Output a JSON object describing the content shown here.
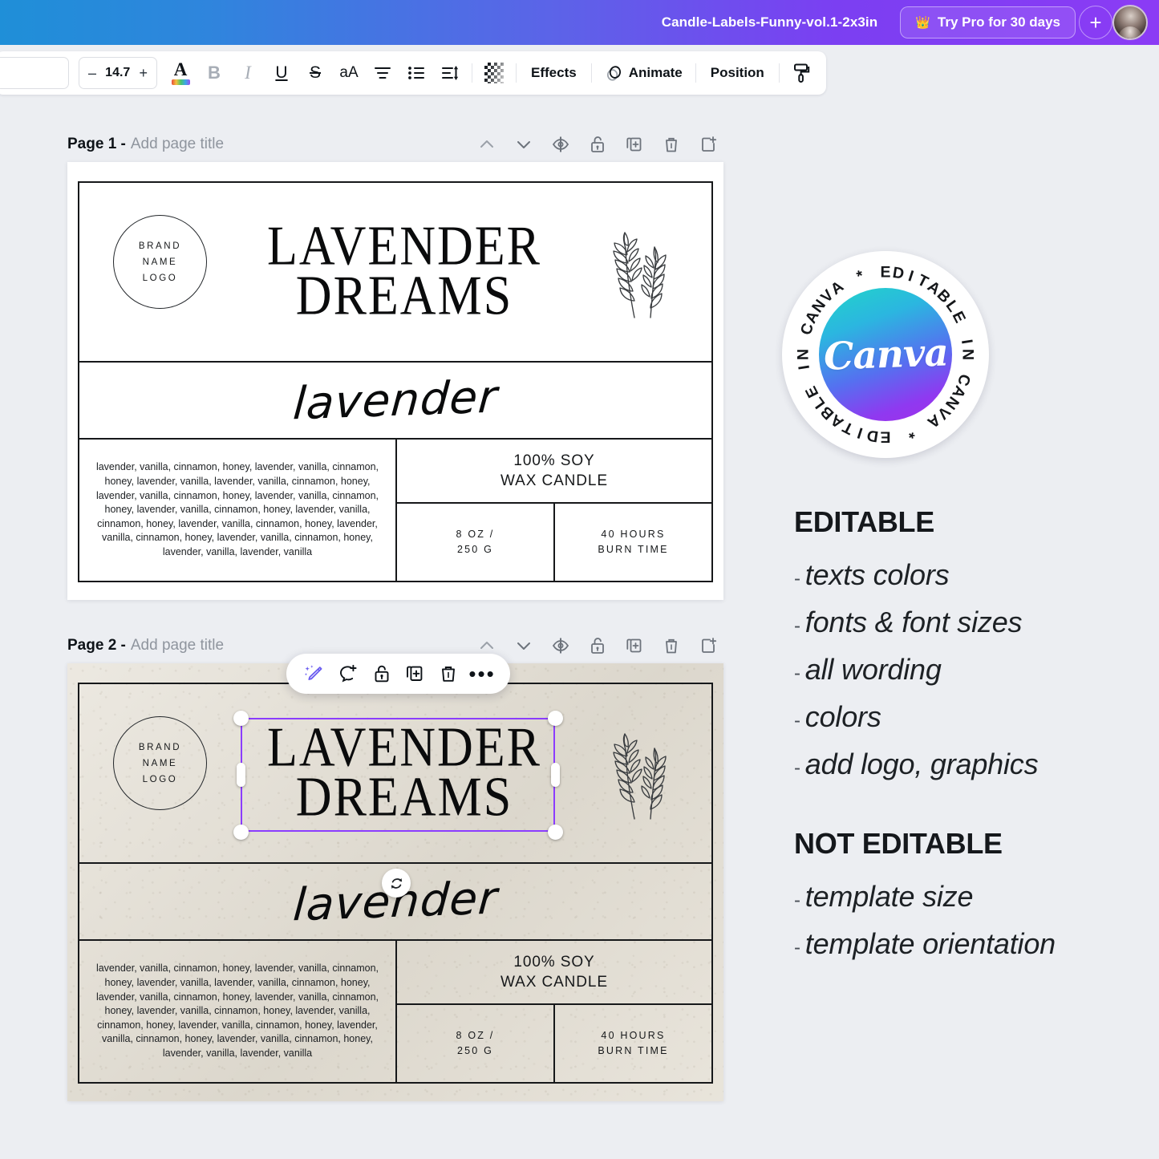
{
  "topbar": {
    "doc_title": "Candle-Labels-Funny-vol.1-2x3in",
    "try_pro_label": "Try Pro for 30 days",
    "crown_icon": "crown-icon",
    "avatar_icon": "user-avatar",
    "plus_label": "+"
  },
  "toolbar": {
    "font_name": "",
    "font_size": "14.7",
    "decrease": "–",
    "increase": "+",
    "text_color_letter": "A",
    "bold": "B",
    "italic": "I",
    "underline": "U",
    "strikethrough": "S",
    "case": "aA",
    "effects_label": "Effects",
    "animate_label": "Animate",
    "position_label": "Position",
    "icons": [
      "text-color-icon",
      "bold-icon",
      "italic-icon",
      "underline-icon",
      "strikethrough-icon",
      "letter-case-icon",
      "align-icon",
      "list-icon",
      "line-spacing-icon",
      "transparency-icon",
      "animate-icon",
      "copy-style-icon"
    ]
  },
  "pages": [
    {
      "number_label": "Page 1 -",
      "title_placeholder": "Add page title",
      "icons": [
        "chevron-up-icon",
        "chevron-down-icon",
        "hide-page-icon",
        "lock-page-icon",
        "duplicate-page-icon",
        "delete-page-icon",
        "add-page-icon"
      ],
      "theme": "white"
    },
    {
      "number_label": "Page 2 -",
      "title_placeholder": "Add page title",
      "icons": [
        "chevron-up-icon",
        "chevron-down-icon",
        "hide-page-icon",
        "lock-page-icon",
        "duplicate-page-icon",
        "delete-page-icon",
        "add-page-icon"
      ],
      "theme": "kraft"
    }
  ],
  "label": {
    "brand_lines": [
      "BRAND",
      "NAME",
      "LOGO"
    ],
    "title_line1": "LAVENDER",
    "title_line2": "DREAMS",
    "script_word": "lavender",
    "ingredients": "lavender, vanilla, cinnamon, honey, lavender, vanilla, cinnamon, honey, lavender, vanilla, lavender, vanilla, cinnamon, honey, lavender, vanilla, cinnamon, honey, lavender, vanilla, cinnamon, honey, lavender, vanilla, cinnamon, honey, lavender, vanilla, cinnamon, honey, lavender, vanilla, cinnamon, honey, lavender, vanilla, cinnamon, honey, lavender, vanilla, cinnamon, honey, lavender, vanilla, lavender, vanilla",
    "soy_line1": "100% SOY",
    "soy_line2": "WAX CANDLE",
    "weight_line1": "8 OZ /",
    "weight_line2": "250 G",
    "burn_line1": "40 HOURS",
    "burn_line2": "BURN TIME",
    "leaf_icon": "botanical-sprig-icon"
  },
  "float_toolbar": {
    "icons": [
      "magic-edit-icon",
      "add-comment-icon",
      "lock-icon",
      "duplicate-icon",
      "delete-icon",
      "more-options-icon"
    ],
    "more_label": "•••"
  },
  "selection": {
    "accent_color": "#8b3dff",
    "rotate_icon": "rotate-icon"
  },
  "badge": {
    "center_word": "Canva",
    "ring_text": "EDITABLE IN CANVA * EDITABLE IN CANVA * "
  },
  "right_panel": {
    "editable_heading": "EDITABLE",
    "editable_items": [
      "texts colors",
      "fonts & font sizes",
      "all wording",
      "colors",
      "add logo, graphics"
    ],
    "not_editable_heading": "NOT EDITABLE",
    "not_editable_items": [
      "template size",
      "template orientation"
    ],
    "dash": "-"
  },
  "colors": {
    "accent_purple": "#8b3dff",
    "topbar_blue": "#1f8fd8",
    "topbar_purple": "#8b3bf5",
    "canvas_bg": "#eceef2",
    "kraft": "#e4dfd4",
    "ink": "#16181a"
  }
}
